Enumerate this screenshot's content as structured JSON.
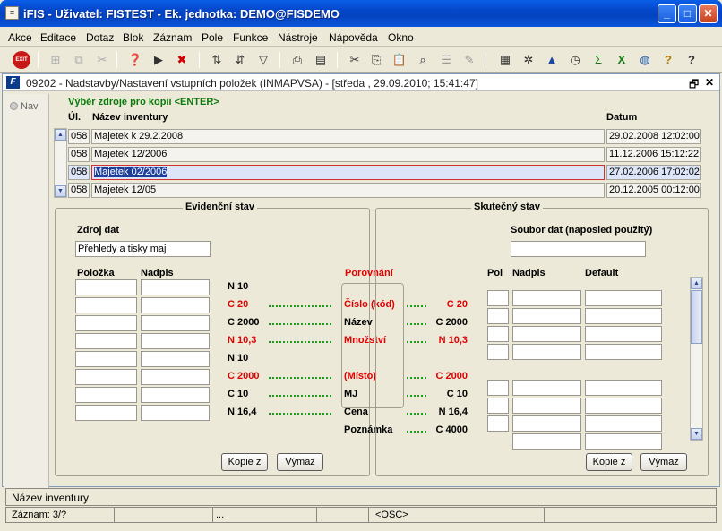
{
  "window": {
    "title": "iFIS - Uživatel: FISTEST - Ek. jednotka: DEMO@FISDEMO",
    "minimize": "_",
    "maximize": "□",
    "close": "✕"
  },
  "menu": [
    {
      "label": "Akce"
    },
    {
      "label": "Editace"
    },
    {
      "label": "Dotaz"
    },
    {
      "label": "Blok"
    },
    {
      "label": "Záznam"
    },
    {
      "label": "Pole"
    },
    {
      "label": "Funkce"
    },
    {
      "label": "Nástroje"
    },
    {
      "label": "Nápověda"
    },
    {
      "label": "Okno"
    }
  ],
  "toolbar": {
    "exit_label": "EXIT"
  },
  "inner": {
    "title": "09202 - Nadstavby/Nastavení vstupních položek (INMAPVSA) - [středa , 29.09.2010; 15:41:47]",
    "restore": "🗗",
    "close": "✕"
  },
  "nav_label": "Nav",
  "source": {
    "heading": "Výběr zdroje pro kopii <ENTER>",
    "columns": {
      "ul": "Úl.",
      "name": "Název inventury",
      "date": "Datum"
    },
    "rows": [
      {
        "ul": "058",
        "name": "Majetek k 29.2.2008",
        "date": "29.02.2008 12:02:00"
      },
      {
        "ul": "058",
        "name": "Majetek 12/2006",
        "date": "11.12.2006 15:12:22"
      },
      {
        "ul": "058",
        "name": "Majetek 02/2006",
        "date": "27.02.2006 17:02:02"
      },
      {
        "ul": "058",
        "name": "Majetek 12/05",
        "date": "20.12.2005 00:12:00"
      }
    ]
  },
  "evid": {
    "title": "Evidenční stav",
    "zdroj_label": "Zdroj dat",
    "zdroj_value": "Přehledy a tisky maj",
    "col_polozka": "Položka",
    "col_nadpis": "Nadpis",
    "types": [
      "N 10",
      "C 20",
      "C 2000",
      "N 10,3",
      "N 10",
      "C 2000",
      "C 10",
      "N 16,4"
    ],
    "types_red": [
      false,
      true,
      false,
      true,
      false,
      true,
      false,
      false
    ],
    "btn_kopie": "Kopie z",
    "btn_vymaz": "Výmaz"
  },
  "compare": {
    "title": "Porovnání",
    "labels": [
      "Číslo (kód)",
      "Název",
      "Množství",
      "(Místo)",
      "MJ",
      "Cena",
      "Poznámka"
    ],
    "labels_red": [
      true,
      false,
      true,
      true,
      false,
      false,
      false
    ]
  },
  "skut": {
    "title": "Skutečný stav",
    "soubor_label": "Soubor dat (naposled použitý)",
    "col_pol": "Pol",
    "col_nadpis": "Nadpis",
    "col_default": "Default",
    "types": [
      "C 20",
      "C 2000",
      "N 10,3",
      "C 2000",
      "C 10",
      "N 16,4",
      "C 4000"
    ],
    "types_red": [
      true,
      false,
      true,
      true,
      false,
      false,
      false
    ],
    "btn_kopie": "Kopie z",
    "btn_vymaz": "Výmaz"
  },
  "status": {
    "hint": "Název inventury",
    "record": "Záznam: 3/?",
    "ellipsis": "...",
    "osc": "<OSC>"
  }
}
